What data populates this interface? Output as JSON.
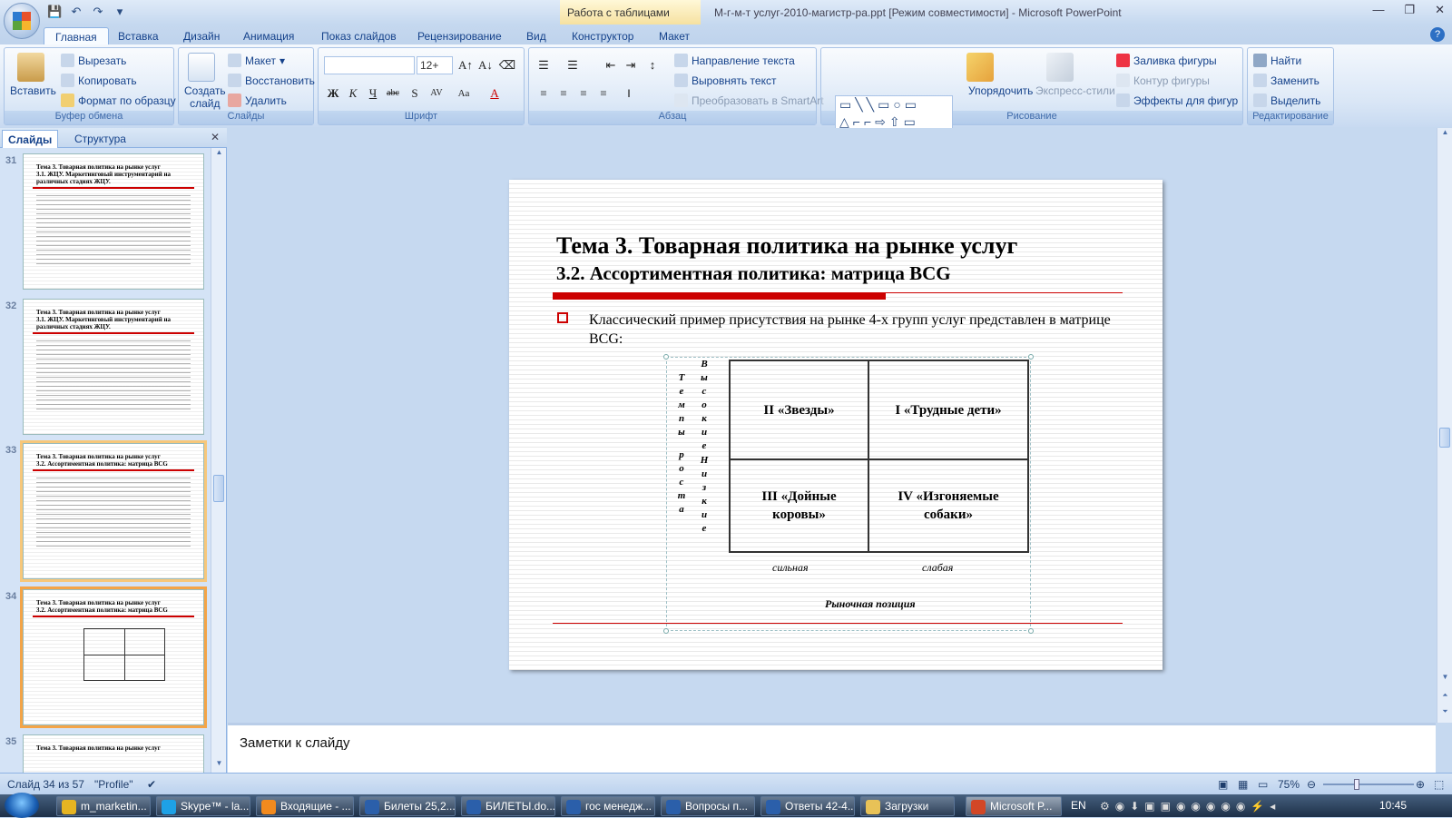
{
  "app": {
    "title": "М-г-м-т услуг-2010-магистр-ра.ppt [Режим совместимости] - Microsoft PowerPoint",
    "context_tab": "Работа с таблицами"
  },
  "ribbon_tabs": [
    "Главная",
    "Вставка",
    "Дизайн",
    "Анимация",
    "Показ слайдов",
    "Рецензирование",
    "Вид",
    "Конструктор",
    "Макет"
  ],
  "clipboard": {
    "paste": "Вставить",
    "cut": "Вырезать",
    "copy": "Копировать",
    "format_painter": "Формат по образцу",
    "label": "Буфер обмена"
  },
  "slides_group": {
    "new_slide": "Создать слайд",
    "layout": "Макет",
    "reset": "Восстановить",
    "delete": "Удалить",
    "label": "Слайды"
  },
  "font_group": {
    "font_name": "",
    "font_size": "12+",
    "label": "Шрифт"
  },
  "paragraph_group": {
    "text_direction": "Направление текста",
    "align_text": "Выровнять текст",
    "smartart": "Преобразовать в SmartArt",
    "label": "Абзац"
  },
  "drawing_group": {
    "arrange": "Упорядочить",
    "quick_styles": "Экспресс-стили",
    "fill": "Заливка фигуры",
    "outline": "Контур фигуры",
    "effects": "Эффекты для фигур",
    "label": "Рисование"
  },
  "editing_group": {
    "find": "Найти",
    "replace": "Заменить",
    "select": "Выделить",
    "label": "Редактирование"
  },
  "panel": {
    "tabs": [
      "Слайды",
      "Структура"
    ],
    "thumbnails": [
      {
        "num": "31",
        "title": "Тема 3. Товарная политика на рынке услуг",
        "subtitle": "3.1. ЖЦУ. Маркетинговый инструментарий на различных стадиях ЖЦУ."
      },
      {
        "num": "32",
        "title": "Тема 3. Товарная политика на рынке услуг",
        "subtitle": "3.1. ЖЦУ. Маркетинговый инструментарий на различных стадиях ЖЦУ."
      },
      {
        "num": "33",
        "title": "Тема 3. Товарная политика на рынке услуг",
        "subtitle": "3.2. Ассортиментная политика: матрица BCG"
      },
      {
        "num": "34",
        "title": "Тема 3. Товарная политика на рынке услуг",
        "subtitle": "3.2. Ассортиментная политика: матрица BCG"
      },
      {
        "num": "35",
        "title": "Тема 3. Товарная политика на рынке услуг",
        "subtitle": ""
      }
    ]
  },
  "slide": {
    "title": "Тема 3. Товарная политика на рынке услуг",
    "subtitle": "3.2. Ассортиментная политика: матрица BCG",
    "bullet": "Классический пример присутствия на рынке 4-х групп услуг представлен в матрице BCG:",
    "matrix": {
      "cells": [
        "II «Звезды»",
        "I «Трудные дети»",
        "III «Дойные коровы»",
        "IV «Изгоняемые собаки»"
      ],
      "col_labels": [
        "сильная",
        "слабая"
      ],
      "x_axis": "Рыночная позиция",
      "y_axis_letters": [
        "Т",
        "е",
        "м",
        "п",
        "ы",
        "р",
        "о",
        "с",
        "т",
        "а"
      ],
      "row_label_high_letters": [
        "В",
        "ы",
        "с",
        "о",
        "к",
        "и",
        "е"
      ],
      "row_label_low_letters": [
        "Н",
        "и",
        "з",
        "к",
        "и",
        "е"
      ]
    }
  },
  "notes": {
    "placeholder": "Заметки к слайду"
  },
  "status": {
    "slide_counter": "Слайд 34 из 57",
    "theme": "\"Profile\"",
    "zoom": "75%"
  },
  "taskbar": {
    "items": [
      "m_marketin...",
      "Skype™ - la...",
      "Входящие - ...",
      "Билеты 25,2...",
      "БИЛЕТЫ.do...",
      "гос менедж...",
      "Вопросы п...",
      "Ответы 42-4...",
      "Загрузки",
      "Microsoft P..."
    ],
    "lang": "EN",
    "clock": "10:45"
  }
}
